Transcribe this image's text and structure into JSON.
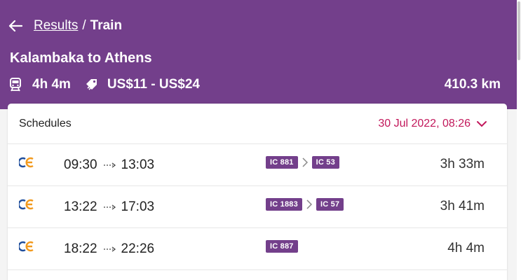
{
  "header": {
    "breadcrumb": {
      "link": "Results",
      "separator": "/",
      "current": "Train"
    },
    "route": "Kalambaka to Athens",
    "duration": "4h 4m",
    "price": "US$11 - US$24",
    "distance": "410.3 km",
    "icons": {
      "back": "arrow-left-icon",
      "duration": "train-icon",
      "price": "price-tag-icon"
    }
  },
  "schedules": {
    "title": "Schedules",
    "date": "30 Jul 2022, 08:26",
    "rows": [
      {
        "depart": "09:30",
        "arrive": "13:03",
        "trains": [
          "IC 881",
          "IC 53"
        ],
        "duration": "3h 33m"
      },
      {
        "depart": "13:22",
        "arrive": "17:03",
        "trains": [
          "IC 1883",
          "IC 57"
        ],
        "duration": "3h 41m"
      },
      {
        "depart": "18:22",
        "arrive": "22:26",
        "trains": [
          "IC 887"
        ],
        "duration": "4h 4m"
      }
    ]
  },
  "colors": {
    "brand": "#733f8b",
    "accent": "#c2185b",
    "logo_blue": "#1f4e9c",
    "logo_orange": "#f29a1e"
  }
}
